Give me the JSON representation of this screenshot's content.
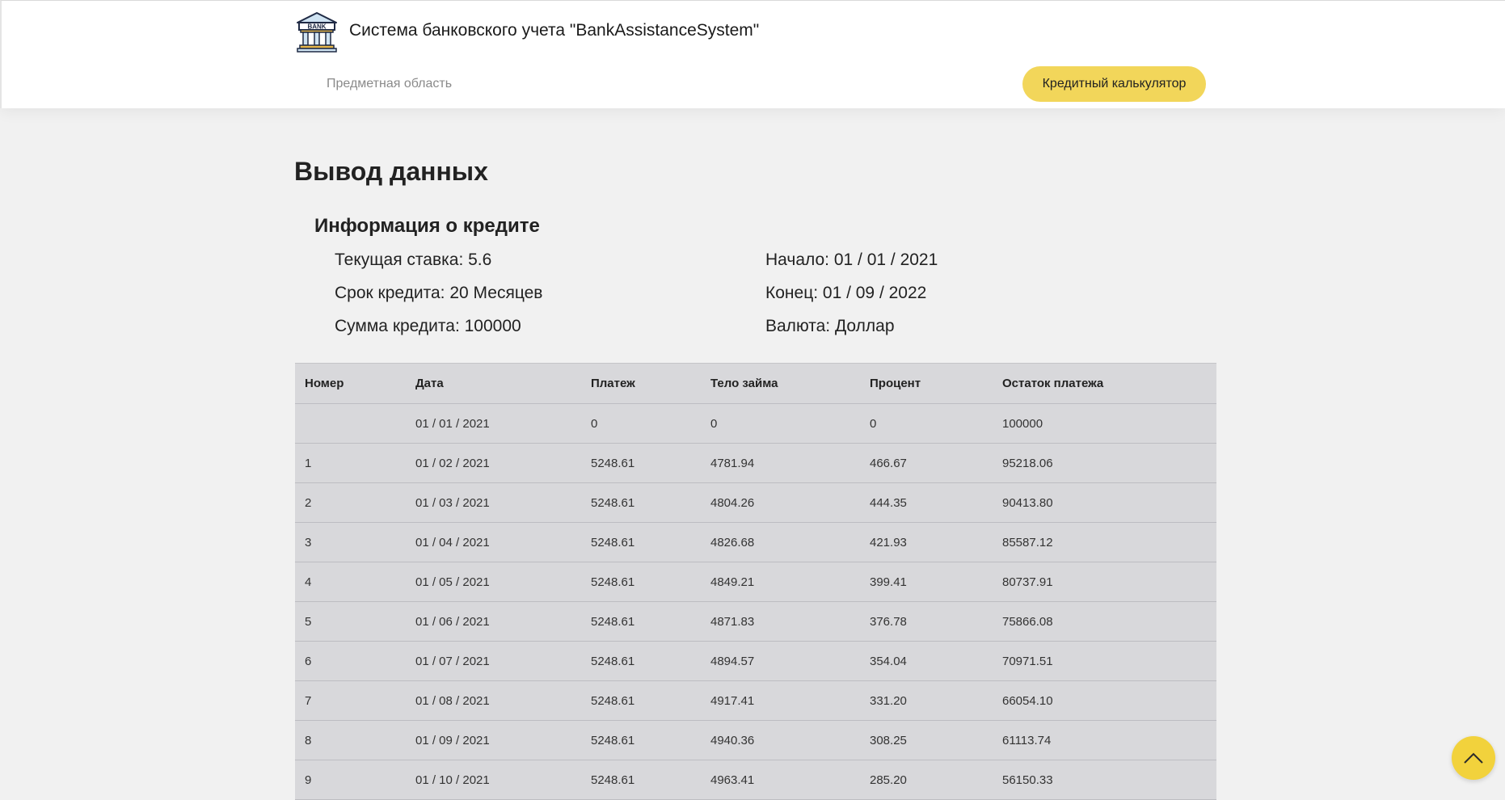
{
  "header": {
    "logo_text": "BANK",
    "title": "Система банковского учета \"BankAssistanceSystem\"",
    "nav_link": "Предметная область",
    "calc_button": "Кредитный калькулятор"
  },
  "main": {
    "title": "Вывод данных",
    "info_title": "Информация о кредите",
    "info": {
      "rate": "Текущая ставка: 5.6",
      "term": "Срок кредита: 20 Месяцев",
      "amount": "Сумма кредита: 100000",
      "start": "Начало: 01 / 01 / 2021",
      "end": "Конец: 01 / 09 / 2022",
      "currency": "Валюта: Доллар"
    },
    "table": {
      "headers": [
        "Номер",
        "Дата",
        "Платеж",
        "Тело займа",
        "Процент",
        "Остаток платежа"
      ],
      "rows": [
        [
          "",
          "01 / 01 / 2021",
          "0",
          "0",
          "0",
          "100000"
        ],
        [
          "1",
          "01 / 02 / 2021",
          "5248.61",
          "4781.94",
          "466.67",
          "95218.06"
        ],
        [
          "2",
          "01 / 03 / 2021",
          "5248.61",
          "4804.26",
          "444.35",
          "90413.80"
        ],
        [
          "3",
          "01 / 04 / 2021",
          "5248.61",
          "4826.68",
          "421.93",
          "85587.12"
        ],
        [
          "4",
          "01 / 05 / 2021",
          "5248.61",
          "4849.21",
          "399.41",
          "80737.91"
        ],
        [
          "5",
          "01 / 06 / 2021",
          "5248.61",
          "4871.83",
          "376.78",
          "75866.08"
        ],
        [
          "6",
          "01 / 07 / 2021",
          "5248.61",
          "4894.57",
          "354.04",
          "70971.51"
        ],
        [
          "7",
          "01 / 08 / 2021",
          "5248.61",
          "4917.41",
          "331.20",
          "66054.10"
        ],
        [
          "8",
          "01 / 09 / 2021",
          "5248.61",
          "4940.36",
          "308.25",
          "61113.74"
        ],
        [
          "9",
          "01 / 10 / 2021",
          "5248.61",
          "4963.41",
          "285.20",
          "56150.33"
        ]
      ]
    }
  },
  "colors": {
    "accent": "#f2d65a",
    "page_bg": "#f1f1f1",
    "table_bg": "#d8d8db"
  },
  "icons": {
    "logo": "bank-building-icon",
    "scroll_top": "chevron-up-icon"
  }
}
